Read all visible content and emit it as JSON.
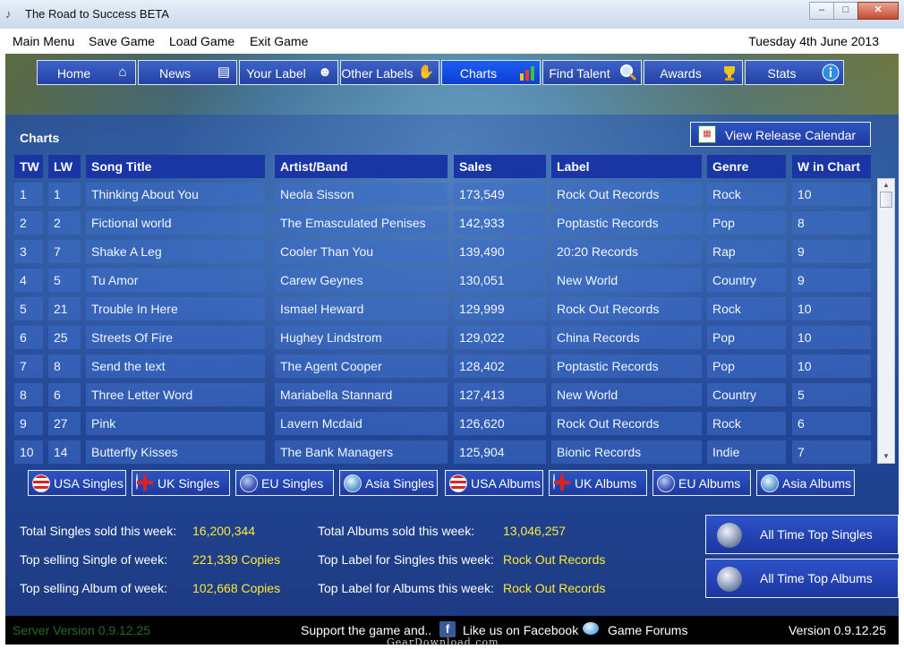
{
  "window": {
    "title": "The Road to Success BETA",
    "icon": "guitar-icon",
    "controls": [
      "minimize",
      "maximize",
      "close"
    ]
  },
  "menu": {
    "items": [
      "Main Menu",
      "Save Game",
      "Load Game",
      "Exit Game"
    ],
    "date": "Tuesday 4th June 2013"
  },
  "nav": [
    {
      "label": "Home",
      "icon": "house-icon"
    },
    {
      "label": "News",
      "icon": "newspaper-icon"
    },
    {
      "label": "Your Label",
      "icon": "person-icon"
    },
    {
      "label": "Other Labels",
      "icon": "handshake-icon"
    },
    {
      "label": "Charts",
      "icon": "bar-chart-icon",
      "active": true
    },
    {
      "label": "Find Talent",
      "icon": "magnifier-icon"
    },
    {
      "label": "Awards",
      "icon": "trophy-icon"
    },
    {
      "label": "Stats",
      "icon": "info-icon"
    }
  ],
  "charts": {
    "section_title": "Charts",
    "calendar_button": "View Release Calendar",
    "columns": [
      "TW",
      "LW",
      "Song Title",
      "Artist/Band",
      "Sales",
      "Label",
      "Genre",
      "W in Chart"
    ],
    "rows": [
      [
        "1",
        "1",
        "Thinking About You",
        "Neola Sisson",
        "173,549",
        "Rock Out Records",
        "Rock",
        "10"
      ],
      [
        "2",
        "2",
        "Fictional world",
        "The Emasculated Penises",
        "142,933",
        "Poptastic Records",
        "Pop",
        "8"
      ],
      [
        "3",
        "7",
        "Shake A Leg",
        "Cooler Than You",
        "139,490",
        "20:20 Records",
        "Rap",
        "9"
      ],
      [
        "4",
        "5",
        "Tu Amor",
        "Carew Geynes",
        "130,051",
        "New World",
        "Country",
        "9"
      ],
      [
        "5",
        "21",
        "Trouble In Here",
        "Ismael Heward",
        "129,999",
        "Rock Out Records",
        "Rock",
        "10"
      ],
      [
        "6",
        "25",
        "Streets Of Fire",
        "Hughey Lindstrom",
        "129,022",
        "China Records",
        "Pop",
        "10"
      ],
      [
        "7",
        "8",
        "Send the text",
        "The Agent Cooper",
        "128,402",
        "Poptastic Records",
        "Pop",
        "10"
      ],
      [
        "8",
        "6",
        "Three Letter Word",
        "Mariabella Stannard",
        "127,413",
        "New World",
        "Country",
        "5"
      ],
      [
        "9",
        "27",
        "Pink",
        "Lavern Mcdaid",
        "126,620",
        "Rock Out Records",
        "Rock",
        "6"
      ],
      [
        "10",
        "14",
        "Butterfly Kisses",
        "The Bank Managers",
        "125,904",
        "Bionic Records",
        "Indie",
        "7"
      ]
    ],
    "chart_buttons": [
      {
        "label": "USA Singles",
        "flag": "usa"
      },
      {
        "label": "UK Singles",
        "flag": "uk"
      },
      {
        "label": "EU Singles",
        "flag": "eu"
      },
      {
        "label": "Asia Singles",
        "flag": "asia"
      },
      {
        "label": "USA Albums",
        "flag": "usa"
      },
      {
        "label": "UK Albums",
        "flag": "uk"
      },
      {
        "label": "EU Albums",
        "flag": "eu"
      },
      {
        "label": "Asia Albums",
        "flag": "asia"
      }
    ]
  },
  "stats": {
    "total_singles_label": "Total Singles sold this week:",
    "total_singles_value": "16,200,344",
    "top_single_label": "Top selling Single of week:",
    "top_single_value": "221,339 Copies",
    "top_album_label": "Top selling Album of week:",
    "top_album_value": "102,668 Copies",
    "total_albums_label": "Total Albums sold this week:",
    "total_albums_value": "13,046,257",
    "top_label_singles_label": "Top Label for Singles this week:",
    "top_label_singles_value": "Rock Out Records",
    "top_label_albums_label": "Top Label for Albums this week:",
    "top_label_albums_value": "Rock Out Records"
  },
  "alltime": {
    "singles": "All Time Top Singles",
    "albums": "All Time Top Albums"
  },
  "footer": {
    "server": "Server Version 0.9.12.25",
    "support": "Support the game and..",
    "facebook": "Like us on Facebook",
    "forums": "Game Forums",
    "version": "Version 0.9.12.25"
  },
  "watermark": "GearDownload.com",
  "colors": {
    "stat_value": "#ffe933",
    "header_cell": "#1936a4",
    "active_nav": "#1c5ef2"
  }
}
